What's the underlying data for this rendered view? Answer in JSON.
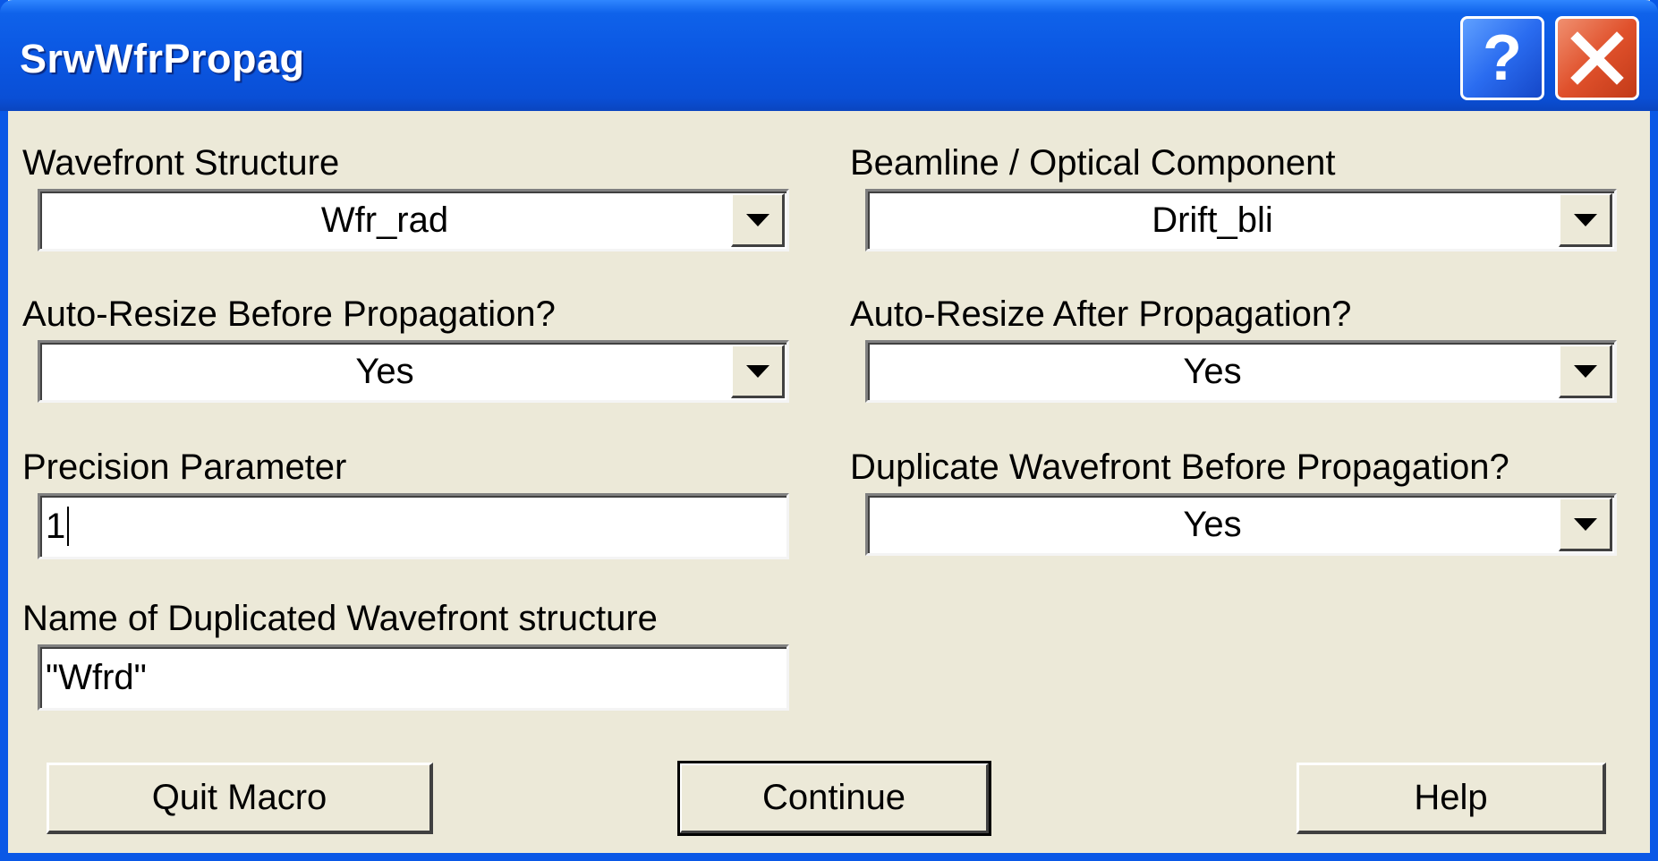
{
  "window": {
    "title": "SrwWfrPropag",
    "help_glyph": "?",
    "close_glyph": "✕"
  },
  "form": {
    "wavefront_structure": {
      "label": "Wavefront Structure",
      "value": "Wfr_rad"
    },
    "optical_component": {
      "label": "Beamline / Optical Component",
      "value": "Drift_bli"
    },
    "resize_before": {
      "label": "Auto-Resize Before Propagation?",
      "value": "Yes"
    },
    "resize_after": {
      "label": "Auto-Resize After Propagation?",
      "value": "Yes"
    },
    "precision": {
      "label": "Precision Parameter",
      "value": "1"
    },
    "duplicate": {
      "label": "Duplicate Wavefront Before Propagation?",
      "value": "Yes"
    },
    "dup_name": {
      "label": "Name of Duplicated Wavefront structure",
      "value": "\"Wfrd\""
    }
  },
  "buttons": {
    "quit": "Quit Macro",
    "continue": "Continue",
    "help": "Help"
  },
  "colors": {
    "titlebar": "#0a58e6",
    "dialog_bg": "#ece9d8",
    "close_button": "#e0512c"
  }
}
